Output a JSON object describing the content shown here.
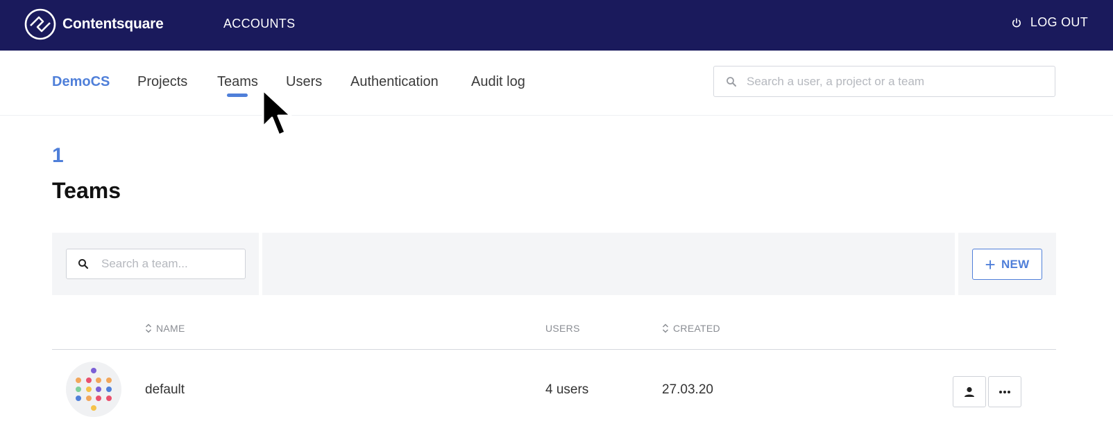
{
  "topbar": {
    "brand": "Contentsquare",
    "nav_item": "ACCOUNTS",
    "logout_label": "LOG OUT",
    "background": "#1a1a5c"
  },
  "subnav": {
    "account": "DemoCS",
    "tabs": [
      "Projects",
      "Teams",
      "Users",
      "Authentication",
      "Audit log"
    ],
    "active_tab": "Teams",
    "search_placeholder": "Search a user, a project or a team",
    "accent": "#4f7fd9"
  },
  "page": {
    "count": "1",
    "title": "Teams"
  },
  "toolbar": {
    "search_placeholder": "Search a team...",
    "new_label": "NEW"
  },
  "table": {
    "columns": {
      "name": "NAME",
      "users": "USERS",
      "created": "CREATED"
    },
    "rows": [
      {
        "name": "default",
        "users": "4 users",
        "created": "27.03.20"
      }
    ]
  },
  "icons": [
    "contentsquare-logo-icon",
    "power-icon",
    "search-icon",
    "sort-icon",
    "plus-icon",
    "user-icon",
    "more-horizontal-icon",
    "cursor-icon"
  ]
}
